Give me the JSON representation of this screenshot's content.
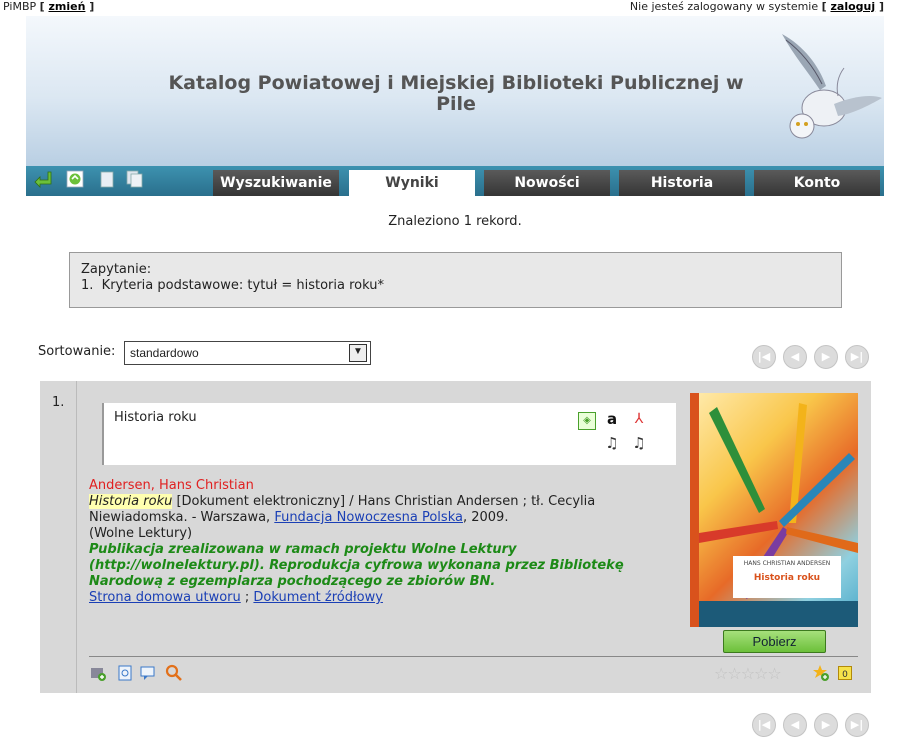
{
  "topbar": {
    "library_code": "PiMBP",
    "change_link": "zmień",
    "login_status": "Nie jesteś zalogowany w systemie",
    "login_link": "zaloguj"
  },
  "banner": {
    "title": "Katalog Powiatowej i Miejskiej Biblioteki Publicznej w Pile"
  },
  "nav": {
    "tools": [
      "back-icon",
      "refresh-icon",
      "copy-icon",
      "copy-all-icon"
    ],
    "tabs": [
      {
        "label": "Wyszukiwanie",
        "active": false
      },
      {
        "label": "Wyniki",
        "active": true
      },
      {
        "label": "Nowości",
        "active": false
      },
      {
        "label": "Historia",
        "active": false
      },
      {
        "label": "Konto",
        "active": false
      }
    ]
  },
  "results": {
    "found_text": "Znaleziono 1 rekord.",
    "query_label": "Zapytanie:",
    "query_line": "1.  Kryteria podstawowe: tytuł = historia roku*",
    "sort_label": "Sortowanie:",
    "sort_value": "standardowo"
  },
  "record": {
    "number": "1.",
    "title": "Historia roku",
    "author": "Andersen, Hans Christian",
    "title_hl": "Historia roku",
    "desc_1": " [Dokument elektroniczny] / Hans Christian Andersen ; tł. Cecylia Niewiadomska. - Warszawa, ",
    "publisher_link": "Fundacja Nowoczesna Polska",
    "desc_2": ", 2009.",
    "series": "(Wolne Lektury)",
    "note": "Publikacja zrealizowana w ramach projektu Wolne Lektury (http://wolnelektury.pl). Reprodukcja cyfrowa wykonana przez Bibliotekę Narodową z egzemplarza pochodzącego ze zbiorów BN.",
    "link_home": "Strona domowa utworu",
    "link_sep": " ; ",
    "link_source": "Dokument źródłowy",
    "cover_author": "HANS CHRISTIAN ANDERSEN",
    "cover_title": "Historia roku",
    "download_label": "Pobierz",
    "stars": "☆☆☆☆☆",
    "rating": 0
  },
  "colors": {
    "nav_bar": "#2a6f8c",
    "tab_dark": "#353535",
    "author_red": "#e02020",
    "note_green": "#1d8a17",
    "link_blue": "#1a3fb5"
  }
}
